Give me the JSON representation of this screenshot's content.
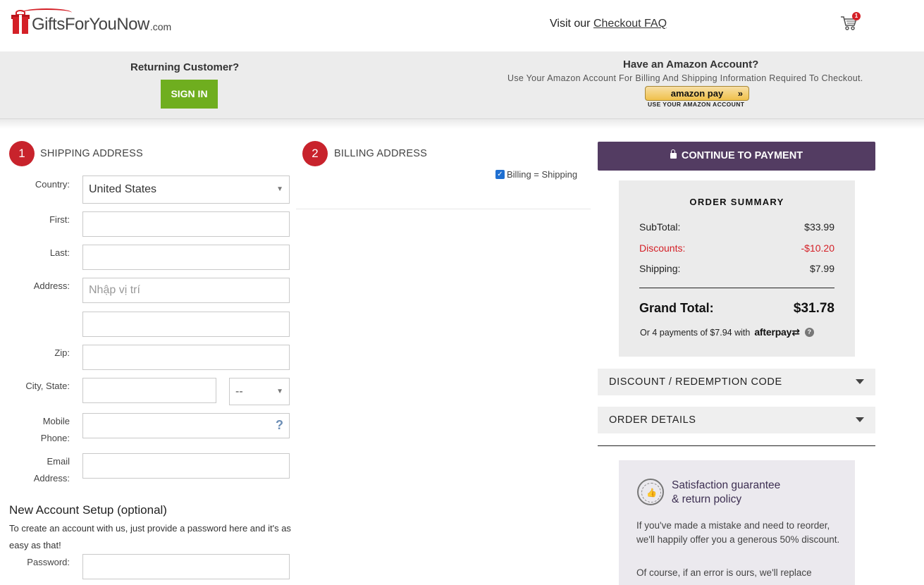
{
  "header": {
    "logo_name": "GiftsForYouNow",
    "logo_suffix": ".com",
    "faq_prefix": "Visit our",
    "faq_link": "Checkout FAQ",
    "cart_count": "1"
  },
  "account_strip": {
    "returning_title": "Returning Customer?",
    "sign_in": "SIGN IN",
    "amazon_title": "Have an Amazon Account?",
    "amazon_subtitle": "Use Your Amazon Account For Billing And Shipping Information Required To Checkout.",
    "amazon_button": "amazon pay",
    "amazon_caption": "USE YOUR AMAZON ACCOUNT"
  },
  "shipping": {
    "step": "1",
    "title": "SHIPPING ADDRESS",
    "labels": {
      "country": "Country:",
      "first": "First:",
      "last": "Last:",
      "address": "Address:",
      "zip": "Zip:",
      "city_state": "City, State:",
      "mobile_1": "Mobile",
      "mobile_2": "Phone:",
      "email_1": "Email",
      "email_2": "Address:",
      "password": "Password:"
    },
    "country_value": "United States",
    "address_placeholder": "Nhập vị trí",
    "state_value": "--",
    "phone_help": "?"
  },
  "new_account": {
    "title": "New Account Setup (optional)",
    "text": "To create an account with us, just provide a password here and it's as easy as that!"
  },
  "billing": {
    "step": "2",
    "title": "BILLING ADDRESS",
    "same_label": "Billing = Shipping",
    "same_checked": true
  },
  "order": {
    "continue_label": "CONTINUE TO PAYMENT",
    "summary_title": "ORDER SUMMARY",
    "subtotal_label": "SubTotal:",
    "subtotal_value": "$33.99",
    "discounts_label": "Discounts:",
    "discounts_value": "-$10.20",
    "shipping_label": "Shipping:",
    "shipping_value": "$7.99",
    "grand_label": "Grand Total:",
    "grand_value": "$31.78",
    "afterpay_text": "Or 4 payments of $7.94 with",
    "afterpay_brand": "afterpay",
    "discount_code_label": "DISCOUNT / REDEMPTION CODE",
    "order_details_label": "ORDER DETAILS"
  },
  "guarantee": {
    "title_1": "Satisfaction guarantee",
    "title_2": "& return policy",
    "para_1": "If you've made a mistake and need to reorder, we'll happily offer you a generous 50% discount.",
    "para_2": "Of course, if an error is ours, we'll replace"
  },
  "colors": {
    "brand_red": "#d42027",
    "sign_in_green": "#6fae1f",
    "continue_purple": "#533c62",
    "discount_red": "#d42027"
  }
}
